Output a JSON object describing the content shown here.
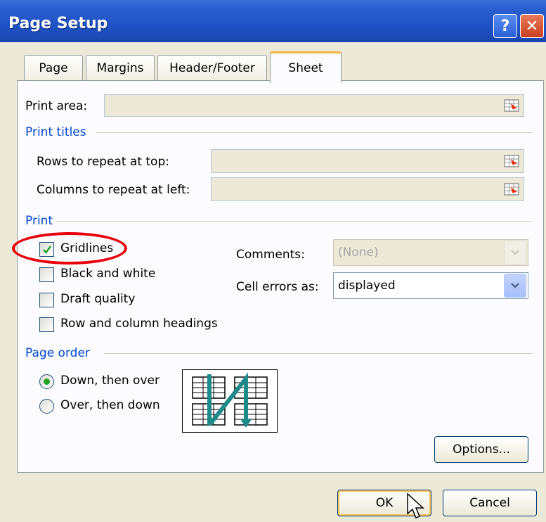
{
  "window": {
    "title": "Page Setup",
    "help_glyph": "?",
    "close_glyph": "✕"
  },
  "tabs": [
    {
      "label": "Page"
    },
    {
      "label": "Margins"
    },
    {
      "label": "Header/Footer"
    },
    {
      "label": "Sheet",
      "active": true
    }
  ],
  "sheet": {
    "print_area_label": "Print area:",
    "print_titles_heading": "Print titles",
    "rows_repeat_label": "Rows to repeat at top:",
    "cols_repeat_label": "Columns to repeat at left:",
    "print_heading": "Print",
    "gridlines_label": "Gridlines",
    "gridlines_checked": true,
    "black_white_label": "Black and white",
    "draft_quality_label": "Draft quality",
    "row_col_headings_label": "Row and column headings",
    "comments_label": "Comments:",
    "comments_value": "(None)",
    "cell_errors_label": "Cell errors as:",
    "cell_errors_value": "displayed",
    "page_order_heading": "Page order",
    "down_then_over_label": "Down, then over",
    "over_then_down_label": "Over, then down",
    "options_button": "Options..."
  },
  "footer": {
    "ok_label": "OK",
    "cancel_label": "Cancel"
  },
  "colors": {
    "accent_text": "#0046d5",
    "highlight_ellipse": "#e8000b",
    "dialog_bg": "#ECE9D8"
  }
}
